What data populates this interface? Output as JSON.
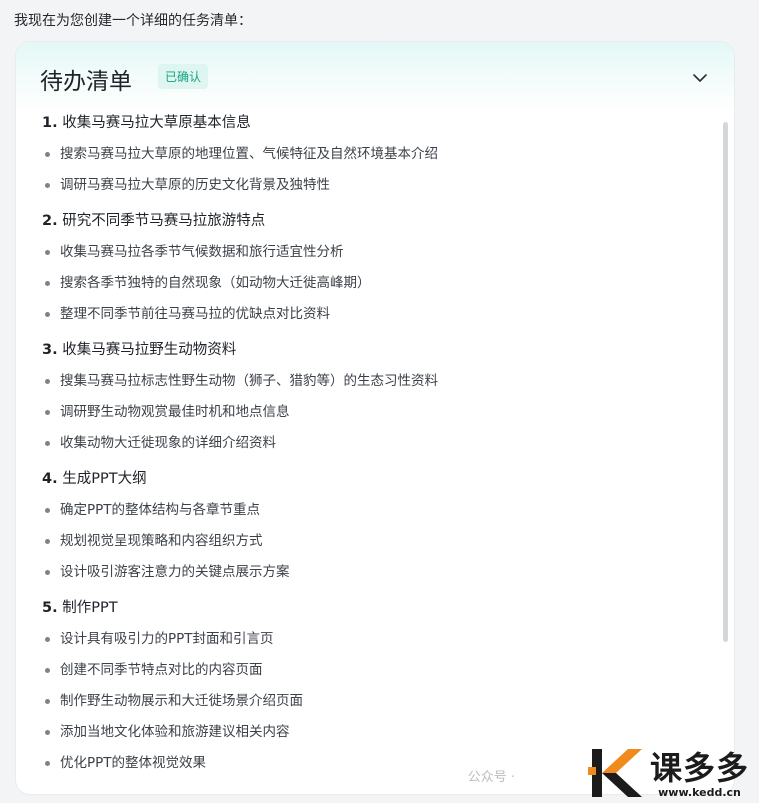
{
  "intro_text": "我现在为您创建一个详细的任务清单：",
  "card": {
    "title": "待办清单",
    "badge": "已确认",
    "badge_color": "#13a386",
    "chevron_icon": "chevron-down-icon"
  },
  "sections": [
    {
      "num": "1.",
      "title": "收集马赛马拉大草原基本信息",
      "items": [
        "搜索马赛马拉大草原的地理位置、气候特征及自然环境基本介绍",
        "调研马赛马拉大草原的历史文化背景及独特性"
      ]
    },
    {
      "num": "2.",
      "title": "研究不同季节马赛马拉旅游特点",
      "items": [
        "收集马赛马拉各季节气候数据和旅行适宜性分析",
        "搜索各季节独特的自然现象（如动物大迁徙高峰期）",
        "整理不同季节前往马赛马拉的优缺点对比资料"
      ]
    },
    {
      "num": "3.",
      "title": "收集马赛马拉野生动物资料",
      "items": [
        "搜集马赛马拉标志性野生动物（狮子、猎豹等）的生态习性资料",
        "调研野生动物观赏最佳时机和地点信息",
        "收集动物大迁徙现象的详细介绍资料"
      ]
    },
    {
      "num": "4.",
      "title": "生成PPT大纲",
      "items": [
        "确定PPT的整体结构与各章节重点",
        "规划视觉呈现策略和内容组织方式",
        "设计吸引游客注意力的关键点展示方案"
      ]
    },
    {
      "num": "5.",
      "title": "制作PPT",
      "items": [
        "设计具有吸引力的PPT封面和引言页",
        "创建不同季节特点对比的内容页面",
        "制作野生动物展示和大迁徙场景介绍页面",
        "添加当地文化体验和旅游建议相关内容",
        "优化PPT的整体视觉效果"
      ]
    }
  ],
  "watermark": {
    "wechat_text": "公众号 ·",
    "logo_main": "课多多",
    "logo_url": "www.kedd.cn",
    "logo_colors": [
      "#f08a1c",
      "#1b1b1b"
    ]
  }
}
